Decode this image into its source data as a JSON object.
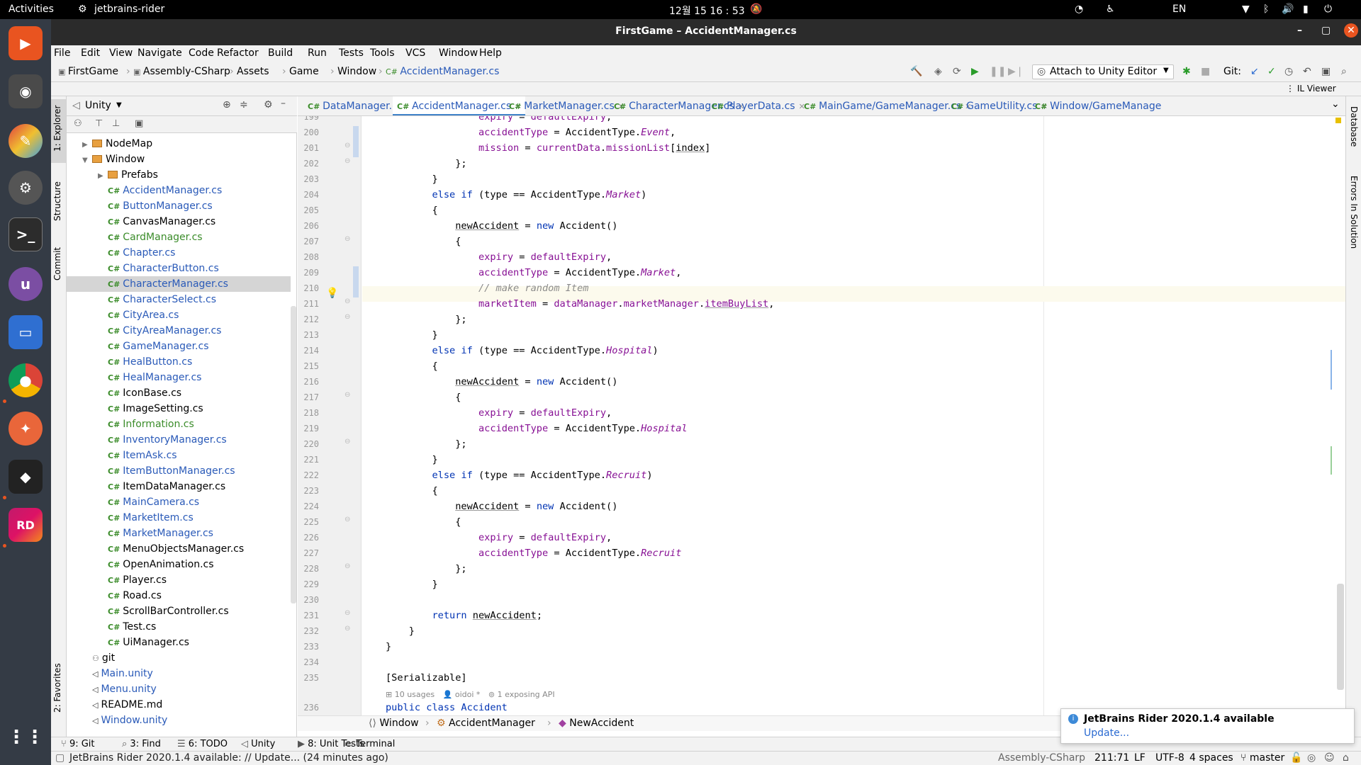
{
  "system": {
    "activities": "Activities",
    "app_name": "jetbrains-rider",
    "clock": "12월 15  16 : 53",
    "lang": "EN"
  },
  "window": {
    "title": "FirstGame – AccidentManager.cs"
  },
  "menu": [
    "File",
    "Edit",
    "View",
    "Navigate",
    "Code",
    "Refactor",
    "Build",
    "Run",
    "Tests",
    "Tools",
    "VCS",
    "Window",
    "Help"
  ],
  "breadcrumb": [
    "FirstGame",
    "Assembly-CSharp",
    "Assets",
    "Game",
    "Window",
    "AccidentManager.cs"
  ],
  "toolbar": {
    "run_config": "Attach to Unity Editor",
    "git_label": "Git:",
    "il_viewer": "IL Viewer"
  },
  "left_tabs": [
    "1: Explorer",
    "Structure",
    "Commit",
    "2: Favorites"
  ],
  "right_tabs": [
    "Database",
    "Errors In Solution"
  ],
  "explorer": {
    "header": "Unity",
    "items": [
      {
        "label": "NodeMap",
        "type": "folder",
        "depth": 1,
        "expand": "▶"
      },
      {
        "label": "Window",
        "type": "folder",
        "depth": 1,
        "expand": "▼"
      },
      {
        "label": "Prefabs",
        "type": "folder",
        "depth": 2,
        "expand": "▶"
      },
      {
        "label": "AccidentManager.cs",
        "type": "cs",
        "depth": 2,
        "color": "#2a5ab8"
      },
      {
        "label": "ButtonManager.cs",
        "type": "cs",
        "depth": 2,
        "color": "#2a5ab8"
      },
      {
        "label": "CanvasManager.cs",
        "type": "cs",
        "depth": 2,
        "color": "#000000"
      },
      {
        "label": "CardManager.cs",
        "type": "cs",
        "depth": 2,
        "color": "#3b8c2a"
      },
      {
        "label": "Chapter.cs",
        "type": "cs",
        "depth": 2,
        "color": "#2a5ab8"
      },
      {
        "label": "CharacterButton.cs",
        "type": "cs",
        "depth": 2,
        "color": "#2a5ab8"
      },
      {
        "label": "CharacterManager.cs",
        "type": "cs",
        "depth": 2,
        "color": "#2a5ab8",
        "selected": true
      },
      {
        "label": "CharacterSelect.cs",
        "type": "cs",
        "depth": 2,
        "color": "#2a5ab8"
      },
      {
        "label": "CityArea.cs",
        "type": "cs",
        "depth": 2,
        "color": "#2a5ab8"
      },
      {
        "label": "CityAreaManager.cs",
        "type": "cs",
        "depth": 2,
        "color": "#2a5ab8"
      },
      {
        "label": "GameManager.cs",
        "type": "cs",
        "depth": 2,
        "color": "#2a5ab8"
      },
      {
        "label": "HealButton.cs",
        "type": "cs",
        "depth": 2,
        "color": "#2a5ab8"
      },
      {
        "label": "HealManager.cs",
        "type": "cs",
        "depth": 2,
        "color": "#2a5ab8"
      },
      {
        "label": "IconBase.cs",
        "type": "cs",
        "depth": 2,
        "color": "#000000"
      },
      {
        "label": "ImageSetting.cs",
        "type": "cs",
        "depth": 2,
        "color": "#000000"
      },
      {
        "label": "Information.cs",
        "type": "cs",
        "depth": 2,
        "color": "#3b8c2a"
      },
      {
        "label": "InventoryManager.cs",
        "type": "cs",
        "depth": 2,
        "color": "#2a5ab8"
      },
      {
        "label": "ItemAsk.cs",
        "type": "cs",
        "depth": 2,
        "color": "#2a5ab8"
      },
      {
        "label": "ItemButtonManager.cs",
        "type": "cs",
        "depth": 2,
        "color": "#2a5ab8"
      },
      {
        "label": "ItemDataManager.cs",
        "type": "cs",
        "depth": 2,
        "color": "#000000"
      },
      {
        "label": "MainCamera.cs",
        "type": "cs",
        "depth": 2,
        "color": "#2a5ab8"
      },
      {
        "label": "MarketItem.cs",
        "type": "cs",
        "depth": 2,
        "color": "#2a5ab8"
      },
      {
        "label": "MarketManager.cs",
        "type": "cs",
        "depth": 2,
        "color": "#2a5ab8"
      },
      {
        "label": "MenuObjectsManager.cs",
        "type": "cs",
        "depth": 2,
        "color": "#000000"
      },
      {
        "label": "OpenAnimation.cs",
        "type": "cs",
        "depth": 2,
        "color": "#000000"
      },
      {
        "label": "Player.cs",
        "type": "cs",
        "depth": 2,
        "color": "#000000"
      },
      {
        "label": "Road.cs",
        "type": "cs",
        "depth": 2,
        "color": "#000000"
      },
      {
        "label": "ScrollBarController.cs",
        "type": "cs",
        "depth": 2,
        "color": "#000000"
      },
      {
        "label": "Test.cs",
        "type": "cs",
        "depth": 2,
        "color": "#000000"
      },
      {
        "label": "UiManager.cs",
        "type": "cs",
        "depth": 2,
        "color": "#000000"
      },
      {
        "label": "git",
        "type": "git",
        "depth": 1,
        "color": "#000000"
      },
      {
        "label": "Main.unity",
        "type": "unity",
        "depth": 1,
        "color": "#2a5ab8"
      },
      {
        "label": "Menu.unity",
        "type": "unity",
        "depth": 1,
        "color": "#2a5ab8"
      },
      {
        "label": "README.md",
        "type": "md",
        "depth": 1,
        "color": "#000000"
      },
      {
        "label": "Window.unity",
        "type": "unity",
        "depth": 1,
        "color": "#2a5ab8"
      }
    ]
  },
  "tabs": [
    {
      "label": "DataManager.cs",
      "active": false
    },
    {
      "label": "AccidentManager.cs",
      "active": true
    },
    {
      "label": "MarketManager.cs",
      "active": false
    },
    {
      "label": "CharacterManager.cs",
      "active": false
    },
    {
      "label": "PlayerData.cs",
      "active": false
    },
    {
      "label": "MainGame/GameManager.cs",
      "active": false
    },
    {
      "label": "GameUtility.cs",
      "active": false
    },
    {
      "label": "Window/GameManage",
      "active": false
    }
  ],
  "code": {
    "lines": [
      {
        "n": "199",
        "html": "                <span class=\"fld\">expiry</span> = <span class=\"fld\">defaultExpiry</span>,"
      },
      {
        "n": "200",
        "html": "                <span class=\"fld\">accidentType</span> = AccidentType.<span class=\"it\">Event</span>,"
      },
      {
        "n": "201",
        "html": "                <span class=\"fld\">mission</span> = <span class=\"fld\">currentData</span>.<span class=\"fld\">missionList</span>[<span class=\"ul\">index</span>]"
      },
      {
        "n": "202",
        "html": "            };"
      },
      {
        "n": "203",
        "html": "        }"
      },
      {
        "n": "204",
        "html": "        <span class=\"kw\">else if</span> (type == AccidentType.<span class=\"it\">Market</span>)"
      },
      {
        "n": "205",
        "html": "        {"
      },
      {
        "n": "206",
        "html": "            <span class=\"ul\">newAccident</span> = <span class=\"kw\">new</span> Accident()"
      },
      {
        "n": "207",
        "html": "            {"
      },
      {
        "n": "208",
        "html": "                <span class=\"fld\">expiry</span> = <span class=\"fld\">defaultExpiry</span>,"
      },
      {
        "n": "209",
        "html": "                <span class=\"fld\">accidentType</span> = AccidentType.<span class=\"it\">Market</span>,"
      },
      {
        "n": "210",
        "html": "                <span class=\"cm\">// make random Item</span>"
      },
      {
        "n": "211",
        "html": "                <span class=\"fld\">marketItem</span> = <span class=\"fld\">dataManager</span>.<span class=\"fld\">marketManager</span>.<span class=\"fld ul\">itemBuyList</span>,"
      },
      {
        "n": "212",
        "html": "            };"
      },
      {
        "n": "213",
        "html": "        }"
      },
      {
        "n": "214",
        "html": "        <span class=\"kw\">else if</span> (type == AccidentType.<span class=\"it\">Hospital</span>)"
      },
      {
        "n": "215",
        "html": "        {"
      },
      {
        "n": "216",
        "html": "            <span class=\"ul\">newAccident</span> = <span class=\"kw\">new</span> Accident()"
      },
      {
        "n": "217",
        "html": "            {"
      },
      {
        "n": "218",
        "html": "                <span class=\"fld\">expiry</span> = <span class=\"fld\">defaultExpiry</span>,"
      },
      {
        "n": "219",
        "html": "                <span class=\"fld\">accidentType</span> = AccidentType.<span class=\"it\">Hospital</span>"
      },
      {
        "n": "220",
        "html": "            };"
      },
      {
        "n": "221",
        "html": "        }"
      },
      {
        "n": "222",
        "html": "        <span class=\"kw\">else if</span> (type == AccidentType.<span class=\"it\">Recruit</span>)"
      },
      {
        "n": "223",
        "html": "        {"
      },
      {
        "n": "224",
        "html": "            <span class=\"ul\">newAccident</span> = <span class=\"kw\">new</span> Accident()"
      },
      {
        "n": "225",
        "html": "            {"
      },
      {
        "n": "226",
        "html": "                <span class=\"fld\">expiry</span> = <span class=\"fld\">defaultExpiry</span>,"
      },
      {
        "n": "227",
        "html": "                <span class=\"fld\">accidentType</span> = AccidentType.<span class=\"it\">Recruit</span>"
      },
      {
        "n": "228",
        "html": "            };"
      },
      {
        "n": "229",
        "html": "        }"
      },
      {
        "n": "230",
        "html": ""
      },
      {
        "n": "231",
        "html": "        <span class=\"kw\">return</span> <span class=\"ul\">newAccident</span>;"
      },
      {
        "n": "232",
        "html": "    }"
      },
      {
        "n": "233",
        "html": "}"
      },
      {
        "n": "234",
        "html": ""
      },
      {
        "n": "235",
        "html": "[Serializable]"
      }
    ],
    "hint_usages": "10 usages",
    "hint_author": "oidoi *",
    "hint_api": "1 exposing API",
    "last_line_n": "236",
    "last_line": "public class Accident"
  },
  "code_breadcrumb": [
    "Window",
    "AccidentManager",
    "NewAccident"
  ],
  "bottom_tools": [
    "9: Git",
    "3: Find",
    "6: TODO",
    "Unity",
    "8: Unit Tests",
    "Terminal"
  ],
  "status": {
    "message": "JetBrains Rider 2020.1.4 available: // Update... (24 minutes ago)",
    "project": "Assembly-CSharp",
    "position": "211:71",
    "line_sep": "LF",
    "encoding": "UTF-8",
    "indent": "4 spaces",
    "branch": "master"
  },
  "notification": {
    "title": "JetBrains Rider 2020.1.4 available",
    "link": "Update..."
  }
}
